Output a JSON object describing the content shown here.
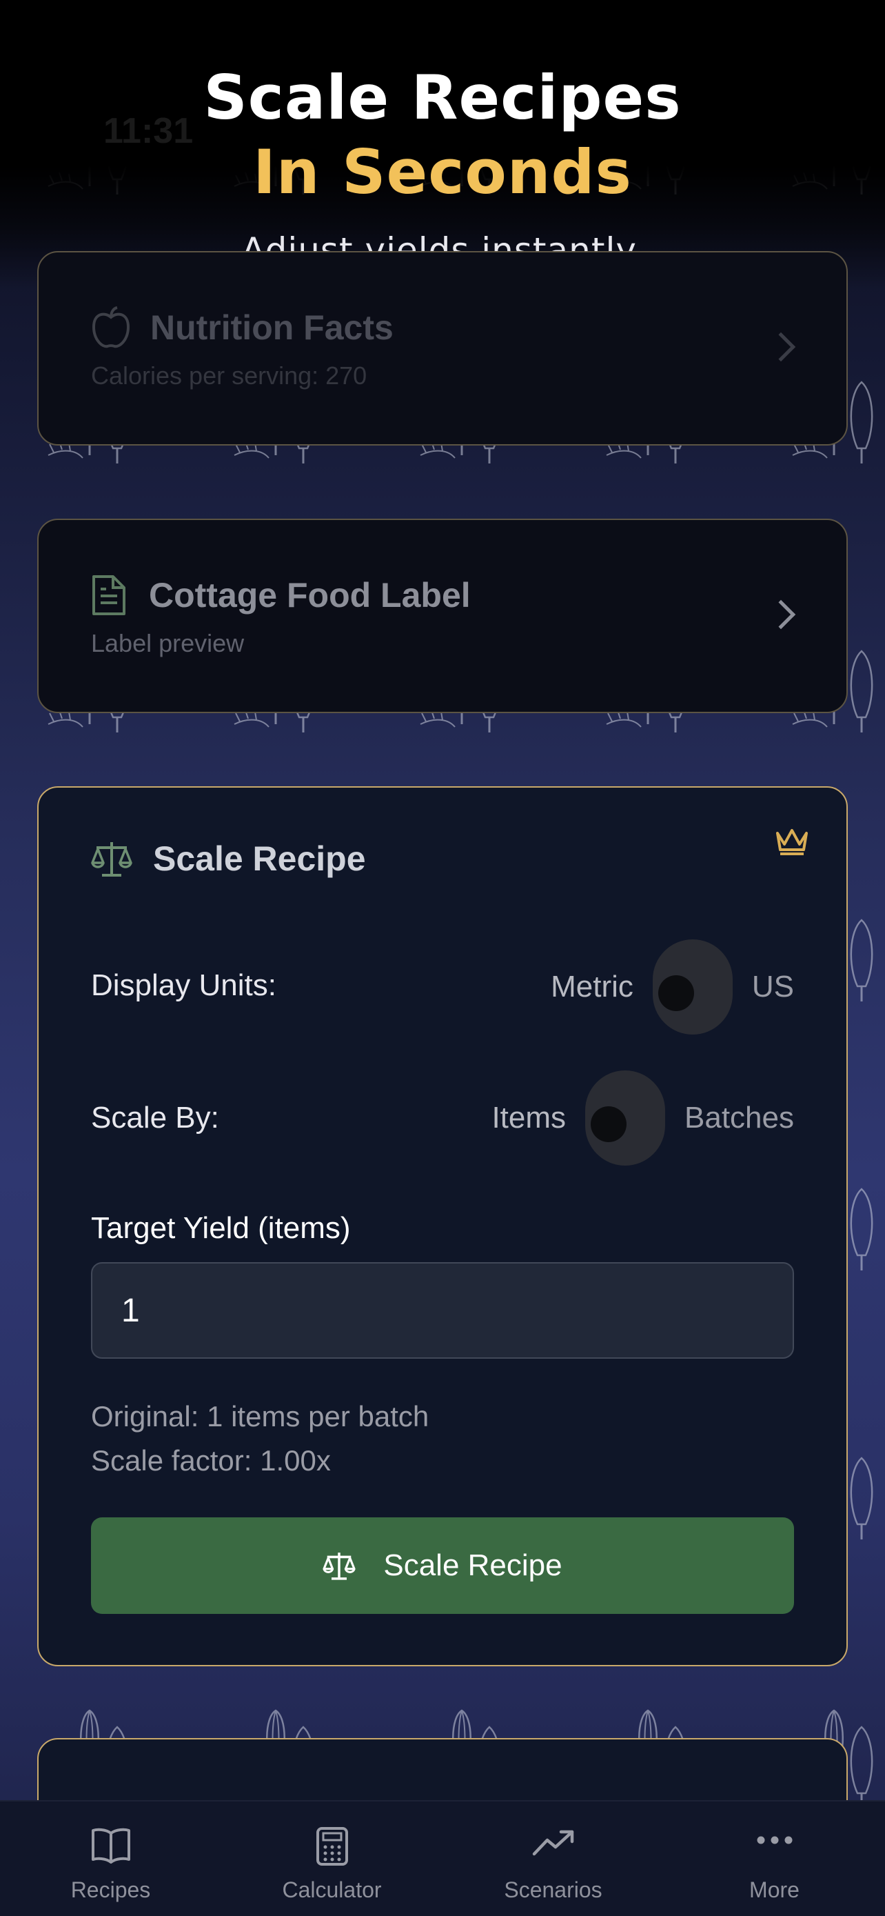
{
  "hero": {
    "title_line1": "Scale Recipes",
    "title_line2": "In Seconds",
    "subtitle": "Adjust yields instantly."
  },
  "status_bar": {
    "time": "11:31"
  },
  "cards": {
    "nutrition": {
      "title": "Nutrition Facts",
      "subtitle": "Calories per serving: 270"
    },
    "cottage": {
      "title": "Cottage Food Label",
      "subtitle": "Label preview"
    }
  },
  "scale_recipe": {
    "title": "Scale Recipe",
    "display_units": {
      "label": "Display Units:",
      "option_left": "Metric",
      "option_right": "US",
      "selected": "Metric"
    },
    "scale_by": {
      "label": "Scale By:",
      "option_left": "Items",
      "option_right": "Batches",
      "selected": "Items"
    },
    "target_yield": {
      "label": "Target Yield (items)",
      "value": "1"
    },
    "original_text": "Original: 1 items per batch",
    "scale_factor_text": "Scale factor: 1.00x",
    "button_label": "Scale Recipe"
  },
  "tabbar": {
    "tabs": [
      {
        "label": "Recipes",
        "icon": "book-icon"
      },
      {
        "label": "Calculator",
        "icon": "calculator-icon"
      },
      {
        "label": "Scenarios",
        "icon": "trending-up-icon"
      },
      {
        "label": "More",
        "icon": "more-dots-icon"
      }
    ]
  },
  "colors": {
    "accent_gold": "#f2c15a",
    "card_border": "#c9a96a",
    "button_green": "#3a6a42",
    "card_bg": "#0f1628"
  }
}
